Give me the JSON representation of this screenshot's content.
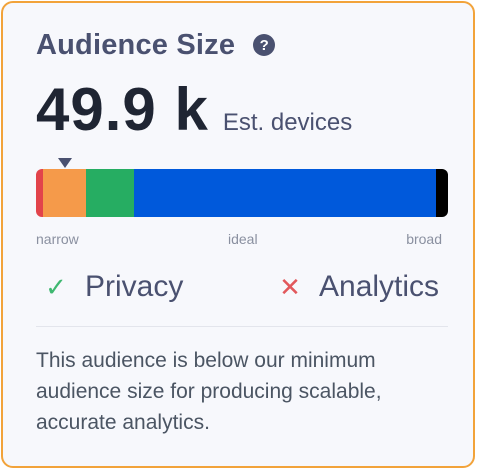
{
  "card": {
    "title": "Audience Size",
    "help_icon": "question-circle-icon",
    "estimate": {
      "value": "49.9 k",
      "unit_label": "Est. devices"
    },
    "scale": {
      "labels": {
        "narrow": "narrow",
        "ideal": "ideal",
        "broad": "broad"
      },
      "marker_position_fraction": 0.07,
      "segments": [
        {
          "name": "too-narrow",
          "color": "#e2434b",
          "fraction": 0.017
        },
        {
          "name": "narrow",
          "color": "#f59a4a",
          "fraction": 0.105
        },
        {
          "name": "okay",
          "color": "#26ad62",
          "fraction": 0.117
        },
        {
          "name": "ideal",
          "color": "#0059db",
          "fraction": 0.731
        },
        {
          "name": "too-broad",
          "color": "#000000",
          "fraction": 0.03
        }
      ]
    },
    "checks": {
      "privacy": {
        "label": "Privacy",
        "icon": "check-icon",
        "color": "#3fb871"
      },
      "analytics": {
        "label": "Analytics",
        "icon": "close-icon",
        "color": "#e2585c"
      }
    },
    "message": "This audience is below our minimum audience size for producing scalable, accurate analytics."
  }
}
